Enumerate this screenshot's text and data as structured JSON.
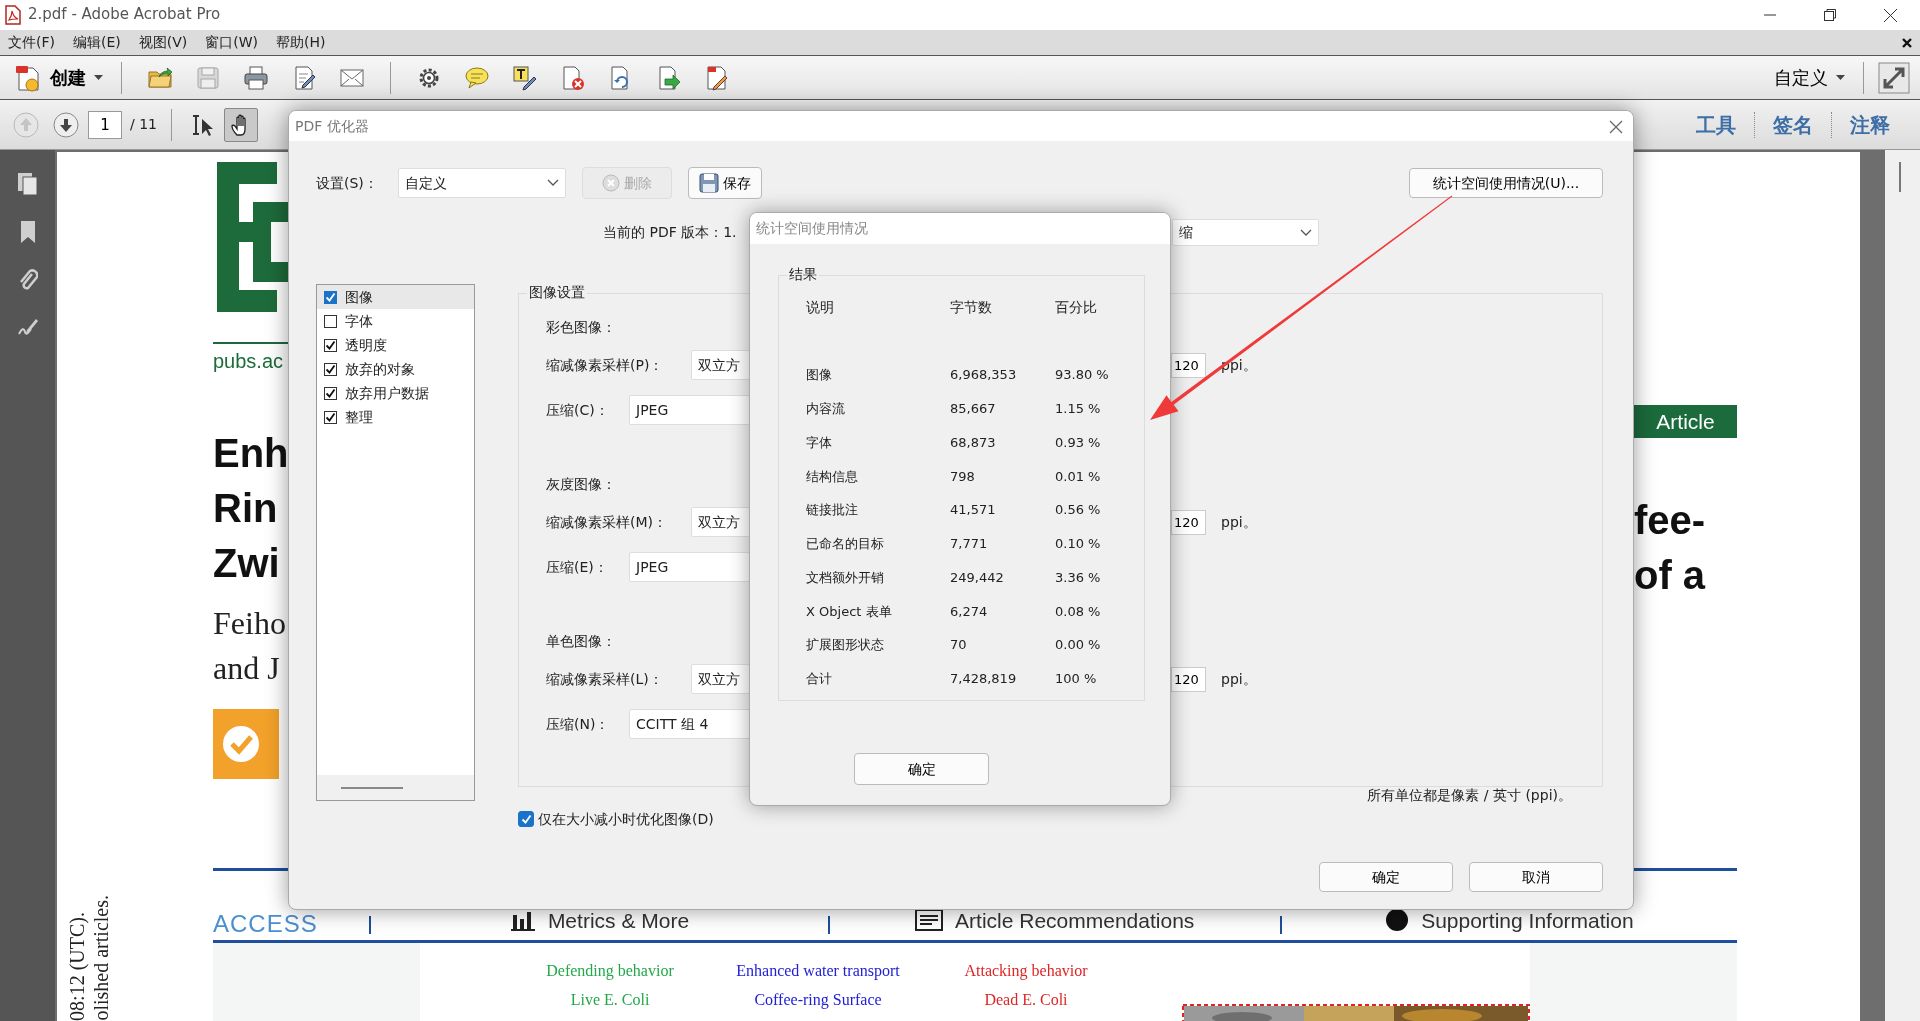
{
  "window": {
    "title": "2.pdf - Adobe Acrobat Pro"
  },
  "menu": [
    {
      "label": "文件(F)"
    },
    {
      "label": "编辑(E)"
    },
    {
      "label": "视图(V)"
    },
    {
      "label": "窗口(W)"
    },
    {
      "label": "帮助(H)"
    }
  ],
  "toolbar": {
    "create": "创建",
    "view": "自定义"
  },
  "navigation": {
    "page": "1",
    "page_count": "/ 11",
    "tools": [
      {
        "kind": "select",
        "selected": false
      },
      {
        "kind": "hand",
        "selected": true
      }
    ],
    "panes": [
      {
        "label": "工具"
      },
      {
        "label": "签名"
      },
      {
        "label": "注释"
      }
    ]
  },
  "document": {
    "site": "pubs.ac",
    "badge": "Article",
    "title_left": [
      "Enh",
      "Rin",
      "Zwi"
    ],
    "title_right": [
      "fee-",
      "of a"
    ],
    "authors_left": [
      "Feiho",
      "and J"
    ],
    "links": [
      {
        "kind": "access",
        "label": "ACCESS"
      },
      {
        "kind": "metrics",
        "label": "Metrics & More"
      },
      {
        "kind": "recommendations",
        "label": "Article Recommendations"
      },
      {
        "kind": "supporting",
        "label": "Supporting Information"
      }
    ],
    "side_note": [
      "08:12 (UTC).",
      "olished articles."
    ],
    "figure": {
      "rows": [
        {
          "labels": [
            {
              "text": "Defending behavior",
              "color": "#22a84a"
            },
            {
              "text": "Enhanced water transport",
              "color": "#2020d8"
            },
            {
              "text": "Attacking behavior",
              "color": "#e02424"
            }
          ]
        },
        {
          "labels": [
            {
              "text": "Live E. Coli",
              "color": "#22a84a"
            },
            {
              "text": "Coffee-ring Surface",
              "color": "#2020d8"
            },
            {
              "text": "Dead E. Coli",
              "color": "#e02424"
            }
          ]
        }
      ]
    }
  },
  "optimizer": {
    "title": "PDF 优化器",
    "settings_label": "设置(S)：",
    "settings_value": "自定义",
    "delete_button": {
      "label": "删除",
      "disabled": true
    },
    "save_button": "保存",
    "audit_button": "统计空间使用情况(U)...",
    "version_label": "当前的 PDF 版本：1.",
    "compat_value": "缩",
    "panels": [
      {
        "label": "图像",
        "checked": true,
        "selected": true
      },
      {
        "label": "字体",
        "checked": false,
        "selected": false
      },
      {
        "label": "透明度",
        "checked": true,
        "selected": false
      },
      {
        "label": "放弃的对象",
        "checked": true,
        "selected": false
      },
      {
        "label": "放弃用户数据",
        "checked": true,
        "selected": false
      },
      {
        "label": "整理",
        "checked": true,
        "selected": false
      }
    ],
    "image_settings": {
      "title": "图像设置",
      "sections": [
        {
          "heading": "彩色图像：",
          "downsample_label": "缩减像素采样(P)：",
          "downsample_value": "双立方",
          "ppi_value": "120",
          "ppi_unit": "ppi。",
          "compression_label": "压缩(C)：",
          "compression_value": "JPEG"
        },
        {
          "heading": "灰度图像：",
          "downsample_label": "缩减像素采样(M)：",
          "downsample_value": "双立方",
          "ppi_value": "120",
          "ppi_unit": "ppi。",
          "compression_label": "压缩(E)：",
          "compression_value": "JPEG"
        },
        {
          "heading": "单色图像：",
          "downsample_label": "缩减像素采样(L)：",
          "downsample_value": "双立方",
          "ppi_value": "120",
          "ppi_unit": "ppi。",
          "compression_label": "压缩(N)：",
          "compression_value": "CCITT 组 4"
        }
      ],
      "units_note": "所有单位都是像素 / 英寸 (ppi)。"
    },
    "optimize_only_if_smaller": {
      "label": "仅在大小减小时优化图像(D)",
      "checked": true
    },
    "buttons": [
      {
        "label": "确定"
      },
      {
        "label": "取消"
      }
    ]
  },
  "space_audit": {
    "title": "统计空间使用情况",
    "group": "结果",
    "columns": [
      "说明",
      "字节数",
      "百分比"
    ],
    "rows": [
      {
        "description": "图像",
        "bytes": "6,968,353",
        "percent": "93.80 %"
      },
      {
        "description": "内容流",
        "bytes": "85,667",
        "percent": "1.15 %"
      },
      {
        "description": "字体",
        "bytes": "68,873",
        "percent": "0.93 %"
      },
      {
        "description": "结构信息",
        "bytes": "798",
        "percent": "0.01 %"
      },
      {
        "description": "链接批注",
        "bytes": "41,571",
        "percent": "0.56 %"
      },
      {
        "description": "已命名的目标",
        "bytes": "7,771",
        "percent": "0.10 %"
      },
      {
        "description": "文档额外开销",
        "bytes": "249,442",
        "percent": "3.36 %"
      },
      {
        "description": "X Object 表单",
        "bytes": "6,274",
        "percent": "0.08 %"
      },
      {
        "description": "扩展图形状态",
        "bytes": "70",
        "percent": "0.00 %"
      },
      {
        "description": "合计",
        "bytes": "7,428,819",
        "percent": "100 %"
      }
    ],
    "ok_button": "确定"
  }
}
